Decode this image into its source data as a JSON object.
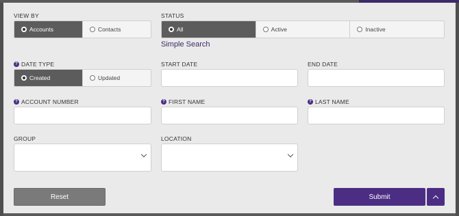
{
  "view_by": {
    "label": "VIEW BY",
    "options": [
      {
        "label": "Accounts",
        "selected": true
      },
      {
        "label": "Contacts",
        "selected": false
      }
    ]
  },
  "status": {
    "label": "STATUS",
    "options": [
      {
        "label": "All",
        "selected": true
      },
      {
        "label": "Active",
        "selected": false
      },
      {
        "label": "Inactive",
        "selected": false
      }
    ]
  },
  "simple_search": "Simple Search",
  "date_type": {
    "label": "DATE TYPE",
    "options": [
      {
        "label": "Created",
        "selected": true
      },
      {
        "label": "Updated",
        "selected": false
      }
    ]
  },
  "start_date": {
    "label": "START DATE",
    "value": ""
  },
  "end_date": {
    "label": "END DATE",
    "value": ""
  },
  "account_number": {
    "label": "ACCOUNT NUMBER",
    "value": ""
  },
  "first_name": {
    "label": "FIRST NAME",
    "value": ""
  },
  "last_name": {
    "label": "LAST NAME",
    "value": ""
  },
  "group": {
    "label": "GROUP",
    "value": ""
  },
  "location": {
    "label": "LOCATION",
    "value": ""
  },
  "buttons": {
    "reset": "Reset",
    "submit": "Submit"
  },
  "colors": {
    "accent": "#4b2e83",
    "active_segment": "#5c5c5c",
    "panel_bg": "#eaeaea"
  }
}
